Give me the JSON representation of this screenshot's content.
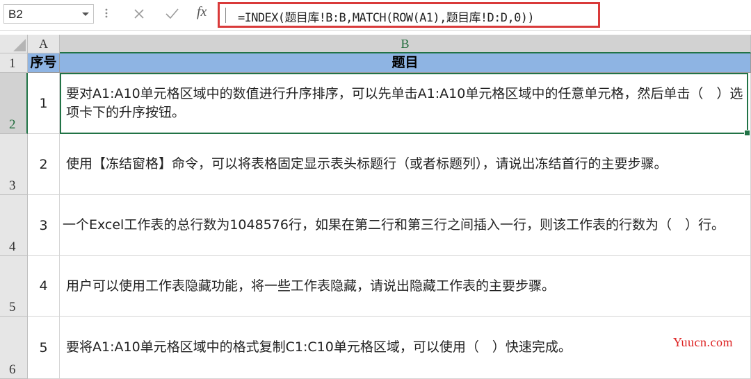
{
  "formula_bar": {
    "name_box": "B2",
    "fx_label": "fx",
    "formula": "=INDEX(题目库!B:B,MATCH(ROW(A1),题目库!D:D,0))"
  },
  "columns": [
    "A",
    "B"
  ],
  "rows": [
    "1",
    "2",
    "3",
    "4",
    "5",
    "6"
  ],
  "table": {
    "headers": [
      "序号",
      "题目"
    ],
    "rows": [
      {
        "num": "1",
        "text": "要对A1:A10单元格区域中的数值进行升序排序，可以先单击A1:A10单元格区域中的任意单元格，然后单击（　）选项卡下的升序按钮。"
      },
      {
        "num": "2",
        "text": "使用【冻结窗格】命令，可以将表格固定显示表头标题行（或者标题列），请说出冻结首行的主要步骤。"
      },
      {
        "num": "3",
        "text": "一个Excel工作表的总行数为1048576行，如果在第二行和第三行之间插入一行，则该工作表的行数为（　）行。"
      },
      {
        "num": "4",
        "text": "用户可以使用工作表隐藏功能，将一些工作表隐藏，请说出隐藏工作表的主要步骤。"
      },
      {
        "num": "5",
        "text": "要将A1:A10单元格区域中的格式复制C1:C10单元格区域，可以使用（　）快速完成。"
      }
    ]
  },
  "watermark": "Yuucn.com",
  "colors": {
    "header_fill": "#8eb4e3",
    "selection": "#217346",
    "formula_highlight": "#d93a3a",
    "watermark": "#dd2222"
  }
}
